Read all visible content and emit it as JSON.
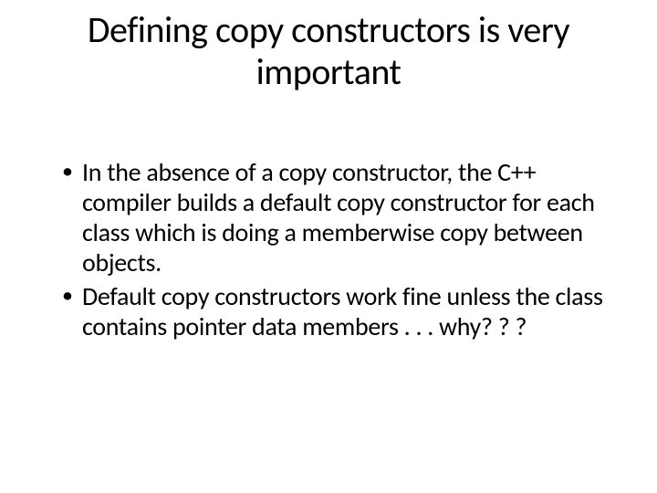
{
  "title": "Defining copy constructors is very important",
  "bullets": [
    "In the absence of a copy constructor, the C++  compiler builds a default copy constructor for each class which is doing a memberwise copy between objects.",
    "Default copy constructors work fine unless the class contains pointer data members . . . why? ? ?"
  ]
}
